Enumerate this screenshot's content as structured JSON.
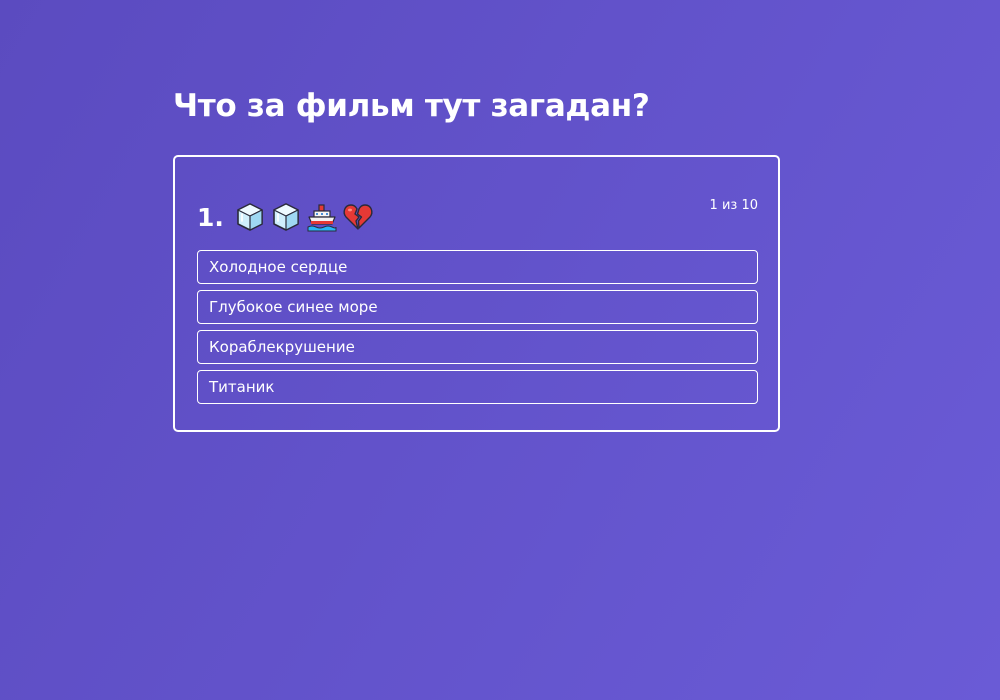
{
  "page": {
    "title": "Что за фильм тут загадан?"
  },
  "question": {
    "number": "1.",
    "emoji_icons": [
      "ice-cube-icon",
      "ice-cube-icon",
      "ship-icon",
      "broken-heart-icon"
    ],
    "progress": "1 из 10"
  },
  "answers": [
    {
      "label": "Холодное сердце"
    },
    {
      "label": "Глубокое синее море"
    },
    {
      "label": "Кораблекрушение"
    },
    {
      "label": "Титаник"
    }
  ],
  "colors": {
    "background_start": "#5b4bc0",
    "background_end": "#6a5bd6",
    "text": "#ffffff",
    "border": "#ffffff"
  }
}
